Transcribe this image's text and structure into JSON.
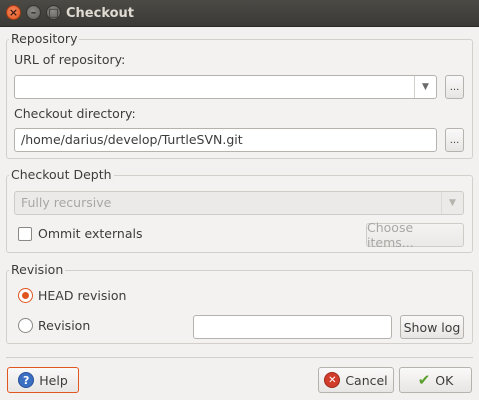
{
  "window": {
    "title": "Checkout",
    "close_glyph": "×",
    "minimize_glyph": "–",
    "maximize_glyph": "□"
  },
  "repository": {
    "group_title": "Repository",
    "url_label": "URL of repository:",
    "url_value": "",
    "url_browse_label": "...",
    "dir_label": "Checkout directory:",
    "dir_value": "/home/darius/develop/TurtleSVN.git",
    "dir_browse_label": "..."
  },
  "depth": {
    "group_title": "Checkout Depth",
    "selected_depth": "Fully recursive",
    "omit_externals_label": "Ommit externals",
    "omit_externals_checked": false,
    "choose_items_label": "Choose items..."
  },
  "revision": {
    "group_title": "Revision",
    "head_label": "HEAD revision",
    "head_selected": true,
    "revision_label": "Revision",
    "revision_value": "",
    "show_log_label": "Show log"
  },
  "buttons": {
    "help_label": "Help",
    "cancel_label": "Cancel",
    "ok_label": "OK"
  },
  "colors": {
    "accent": "#e1551f",
    "titlebar": "#3b3a36"
  },
  "icons": {
    "help": "help-icon",
    "cancel": "cancel-icon",
    "ok": "ok-checkmark-icon",
    "dropdown": "chevron-down-icon"
  }
}
